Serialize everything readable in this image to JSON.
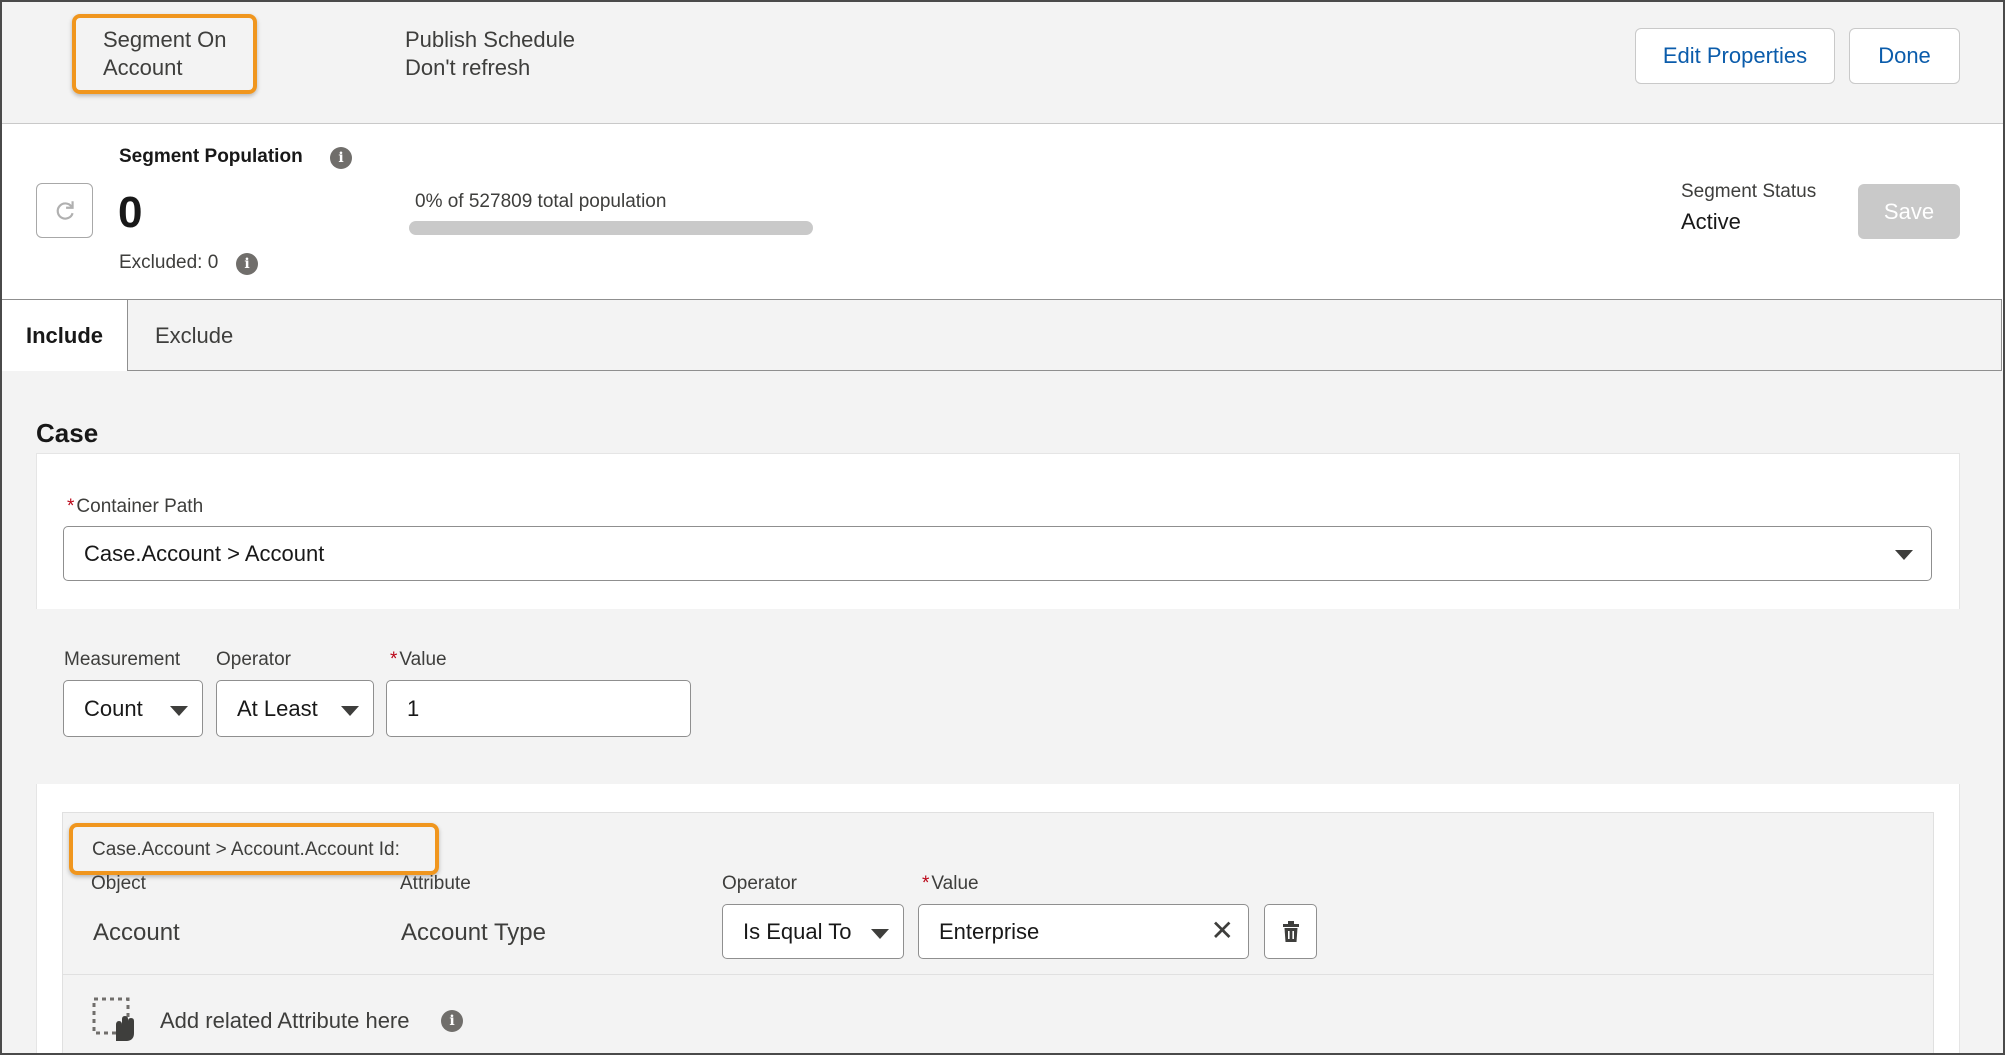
{
  "header": {
    "segment_on": [
      "Segment On",
      "Account"
    ],
    "publish_schedule": [
      "Publish Schedule",
      "Don't refresh"
    ],
    "edit_properties_label": "Edit Properties",
    "done_label": "Done",
    "highlight_color": "#f0961e"
  },
  "population": {
    "title": "Segment Population",
    "count": "0",
    "excluded": "Excluded: 0",
    "percent_text": "0% of 527809 total population",
    "progress_fraction": 0,
    "status_label": "Segment Status",
    "status_value": "Active",
    "save_label": "Save"
  },
  "tabs": [
    {
      "label": "Include",
      "active": true
    },
    {
      "label": "Exclude",
      "active": false
    }
  ],
  "section": {
    "title": "Case",
    "container_path_label": "Container Path",
    "container_path_value": "Case.Account > Account",
    "measurement_label": "Measurement",
    "measurement_value": "Count",
    "operator_label": "Operator",
    "operator_value": "At Least",
    "value_label": "Value",
    "value_value": "1"
  },
  "filter": {
    "path": "Case.Account > Account.Account Id:",
    "object_label": "Object",
    "object_value": "Account",
    "attribute_label": "Attribute",
    "attribute_value": "Account Type",
    "operator_label": "Operator",
    "operator_value": "Is Equal To",
    "value_label": "Value",
    "value_value": "Enterprise",
    "add_related": "Add related Attribute here"
  },
  "icons": {
    "refresh": "refresh-icon",
    "info": "info-icon",
    "caret": "chevron-down-icon",
    "clear": "close-icon",
    "delete": "trash-icon",
    "drag": "drag-drop-icon"
  }
}
